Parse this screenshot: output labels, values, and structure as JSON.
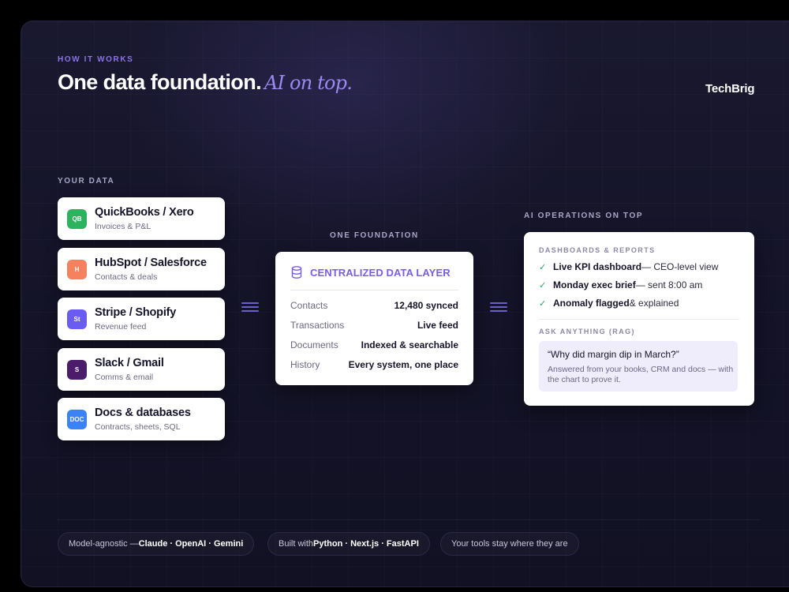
{
  "eyebrow": "HOW IT WORKS",
  "headline": {
    "main": "One data foundation.",
    "italic": "AI on top."
  },
  "brand": "TechBrig",
  "your_data": {
    "label": "YOUR DATA",
    "sources": [
      {
        "badge": "QB",
        "title": "QuickBooks / Xero",
        "sub": "Invoices & P&L",
        "color": "#2db35d"
      },
      {
        "badge": "H",
        "title": "HubSpot / Salesforce",
        "sub": "Contacts & deals",
        "color": "#f5825e"
      },
      {
        "badge": "St",
        "title": "Stripe / Shopify",
        "sub": "Revenue feed",
        "color": "#6a5cf0"
      },
      {
        "badge": "S",
        "title": "Slack / Gmail",
        "sub": "Comms & email",
        "color": "#4a1c6a"
      },
      {
        "badge": "DOC",
        "title": "Docs & databases",
        "sub": "Contracts, sheets, SQL",
        "color": "#3b82f6"
      }
    ]
  },
  "foundation": {
    "label": "ONE FOUNDATION",
    "title": "CENTRALIZED DATA LAYER",
    "icon": "database-icon",
    "rows": [
      {
        "k": "Contacts",
        "v": "12,480 synced"
      },
      {
        "k": "Transactions",
        "v": "Live feed"
      },
      {
        "k": "Documents",
        "v": "Indexed & searchable"
      },
      {
        "k": "History",
        "v": "Every system, one place"
      }
    ]
  },
  "ai_ops": {
    "label": "AI OPERATIONS ON TOP",
    "dashboards_label": "DASHBOARDS & REPORTS",
    "items": [
      {
        "bold": "Live KPI dashboard",
        "rest": " — CEO-level view"
      },
      {
        "bold": "Monday exec brief",
        "rest": " — sent 8:00 am"
      },
      {
        "bold": "Anomaly flagged",
        "rest": " & explained"
      }
    ],
    "ask_label": "ASK ANYTHING (RAG)",
    "question": "“Why did margin dip in March?”",
    "answer": "Answered from your books, CRM and docs — with the chart to prove it."
  },
  "pills": [
    {
      "pre": "Model-agnostic — ",
      "bold": "Claude · OpenAI · Gemini"
    },
    {
      "pre": "Built with ",
      "bold": "Python · Next.js · FastAPI"
    },
    {
      "pre": "Your tools stay where they are",
      "bold": ""
    }
  ],
  "colors": {
    "accent": "#7a5ce6",
    "italic_accent": "#9a8af0",
    "check": "#2fa06a"
  }
}
